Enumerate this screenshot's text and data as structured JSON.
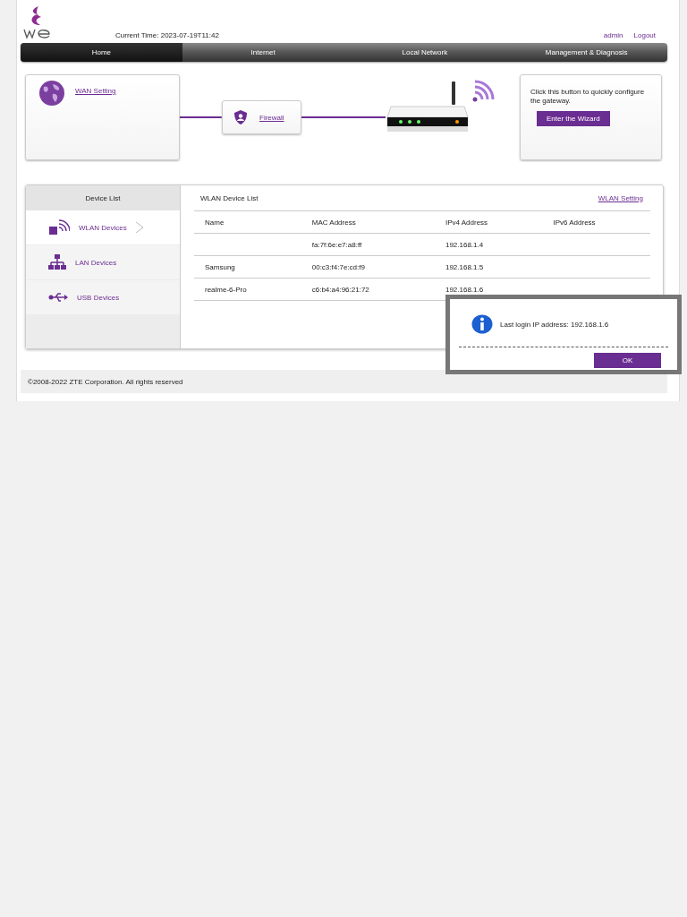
{
  "header": {
    "current_time": "Current Time: 2023-07-19T11:42",
    "user": "admin",
    "logout": "Logout"
  },
  "nav": [
    {
      "label": "Home",
      "selected": true
    },
    {
      "label": "Internet",
      "selected": false
    },
    {
      "label": "Local Network",
      "selected": false
    },
    {
      "label": "Management & Diagnosis",
      "selected": false
    }
  ],
  "topology": {
    "wan_link": "WAN Setting",
    "firewall_link": "Firewall",
    "wizard_text": "Click this button to quickly configure the gateway.",
    "wizard_button": "Enter the Wizard"
  },
  "device_list": {
    "title": "Device List",
    "items": [
      {
        "label": "WLAN Devices",
        "kind": "wlan",
        "selected": true
      },
      {
        "label": "LAN Devices",
        "kind": "lan",
        "selected": false
      },
      {
        "label": "USB Devices",
        "kind": "usb",
        "selected": false
      }
    ]
  },
  "table": {
    "title": "WLAN Device List",
    "link": "WLAN Setting",
    "columns": [
      "Name",
      "MAC Address",
      "IPv4 Address",
      "IPv6 Address"
    ],
    "rows": [
      [
        "",
        "fa:7f:6e:e7:a8:ff",
        "192.168.1.4",
        ""
      ],
      [
        "Samsung",
        "00:c3:f4:7e:cd:f9",
        "192.168.1.5",
        ""
      ],
      [
        "realme-6-Pro",
        "c6:b4:a4:96:21:72",
        "192.168.1.6",
        ""
      ]
    ]
  },
  "footer": "©2008-2022 ZTE Corporation. All rights reserved",
  "dialog": {
    "message": "Last login IP address: 192.168.1.6",
    "button": "OK"
  }
}
